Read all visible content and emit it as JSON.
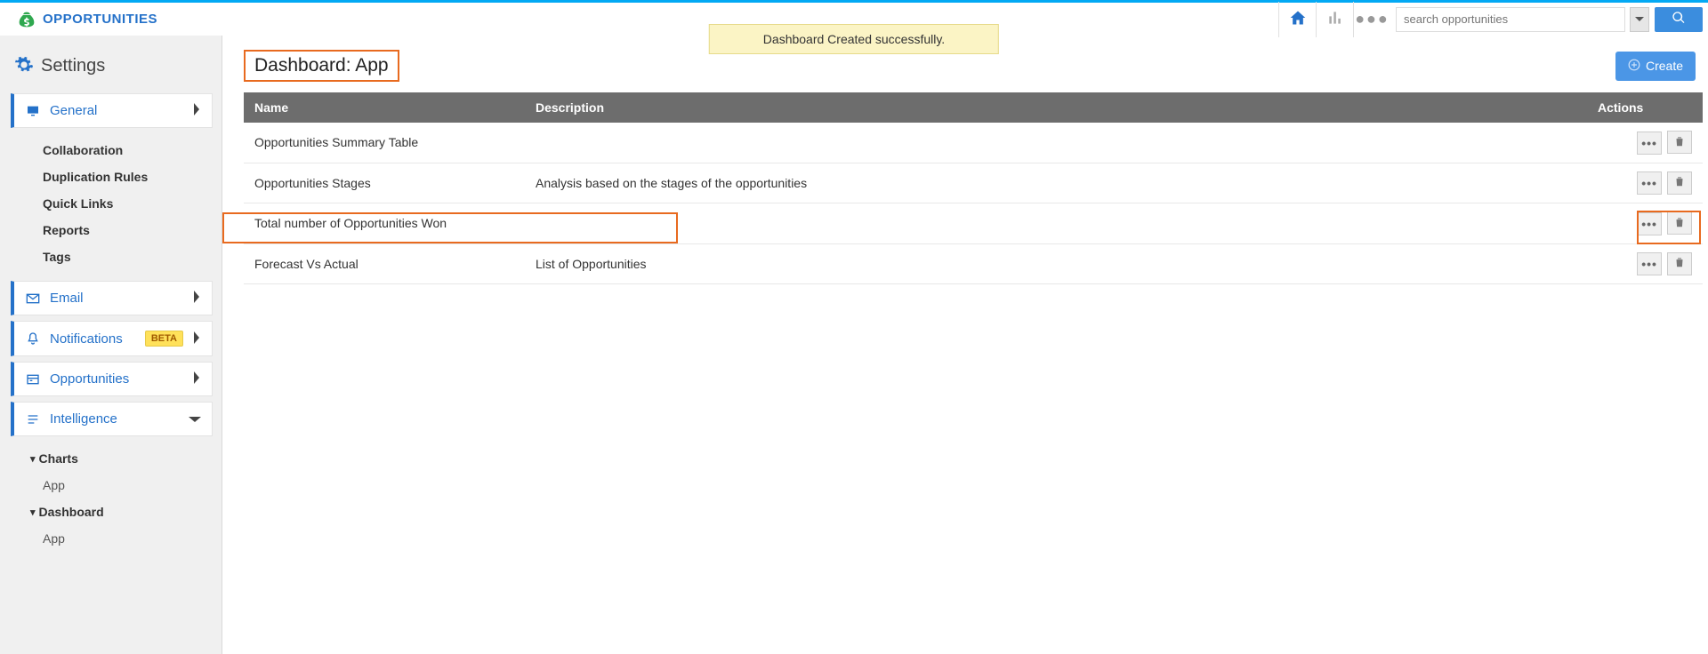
{
  "brand": "OPPORTUNITIES",
  "notice": "Dashboard Created successfully.",
  "search": {
    "placeholder": "search opportunities"
  },
  "settings_title": "Settings",
  "nav": {
    "general": "General",
    "general_children": [
      "Collaboration",
      "Duplication Rules",
      "Quick Links",
      "Reports",
      "Tags"
    ],
    "email": "Email",
    "notifications": "Notifications",
    "notifications_badge": "BETA",
    "opportunities": "Opportunities",
    "intelligence": "Intelligence",
    "intel_groups": {
      "charts": "Charts",
      "charts_children": [
        "App"
      ],
      "dashboard": "Dashboard",
      "dashboard_children": [
        "App"
      ]
    }
  },
  "page": {
    "title": "Dashboard: App",
    "create": "Create",
    "columns": {
      "name": "Name",
      "description": "Description",
      "actions": "Actions"
    },
    "rows": [
      {
        "name": "Opportunities Summary Table",
        "description": ""
      },
      {
        "name": "Opportunities Stages",
        "description": "Analysis based on the stages of the opportunities"
      },
      {
        "name": "Total number of Opportunities Won",
        "description": ""
      },
      {
        "name": "Forecast Vs Actual",
        "description": "List of Opportunities"
      }
    ]
  }
}
